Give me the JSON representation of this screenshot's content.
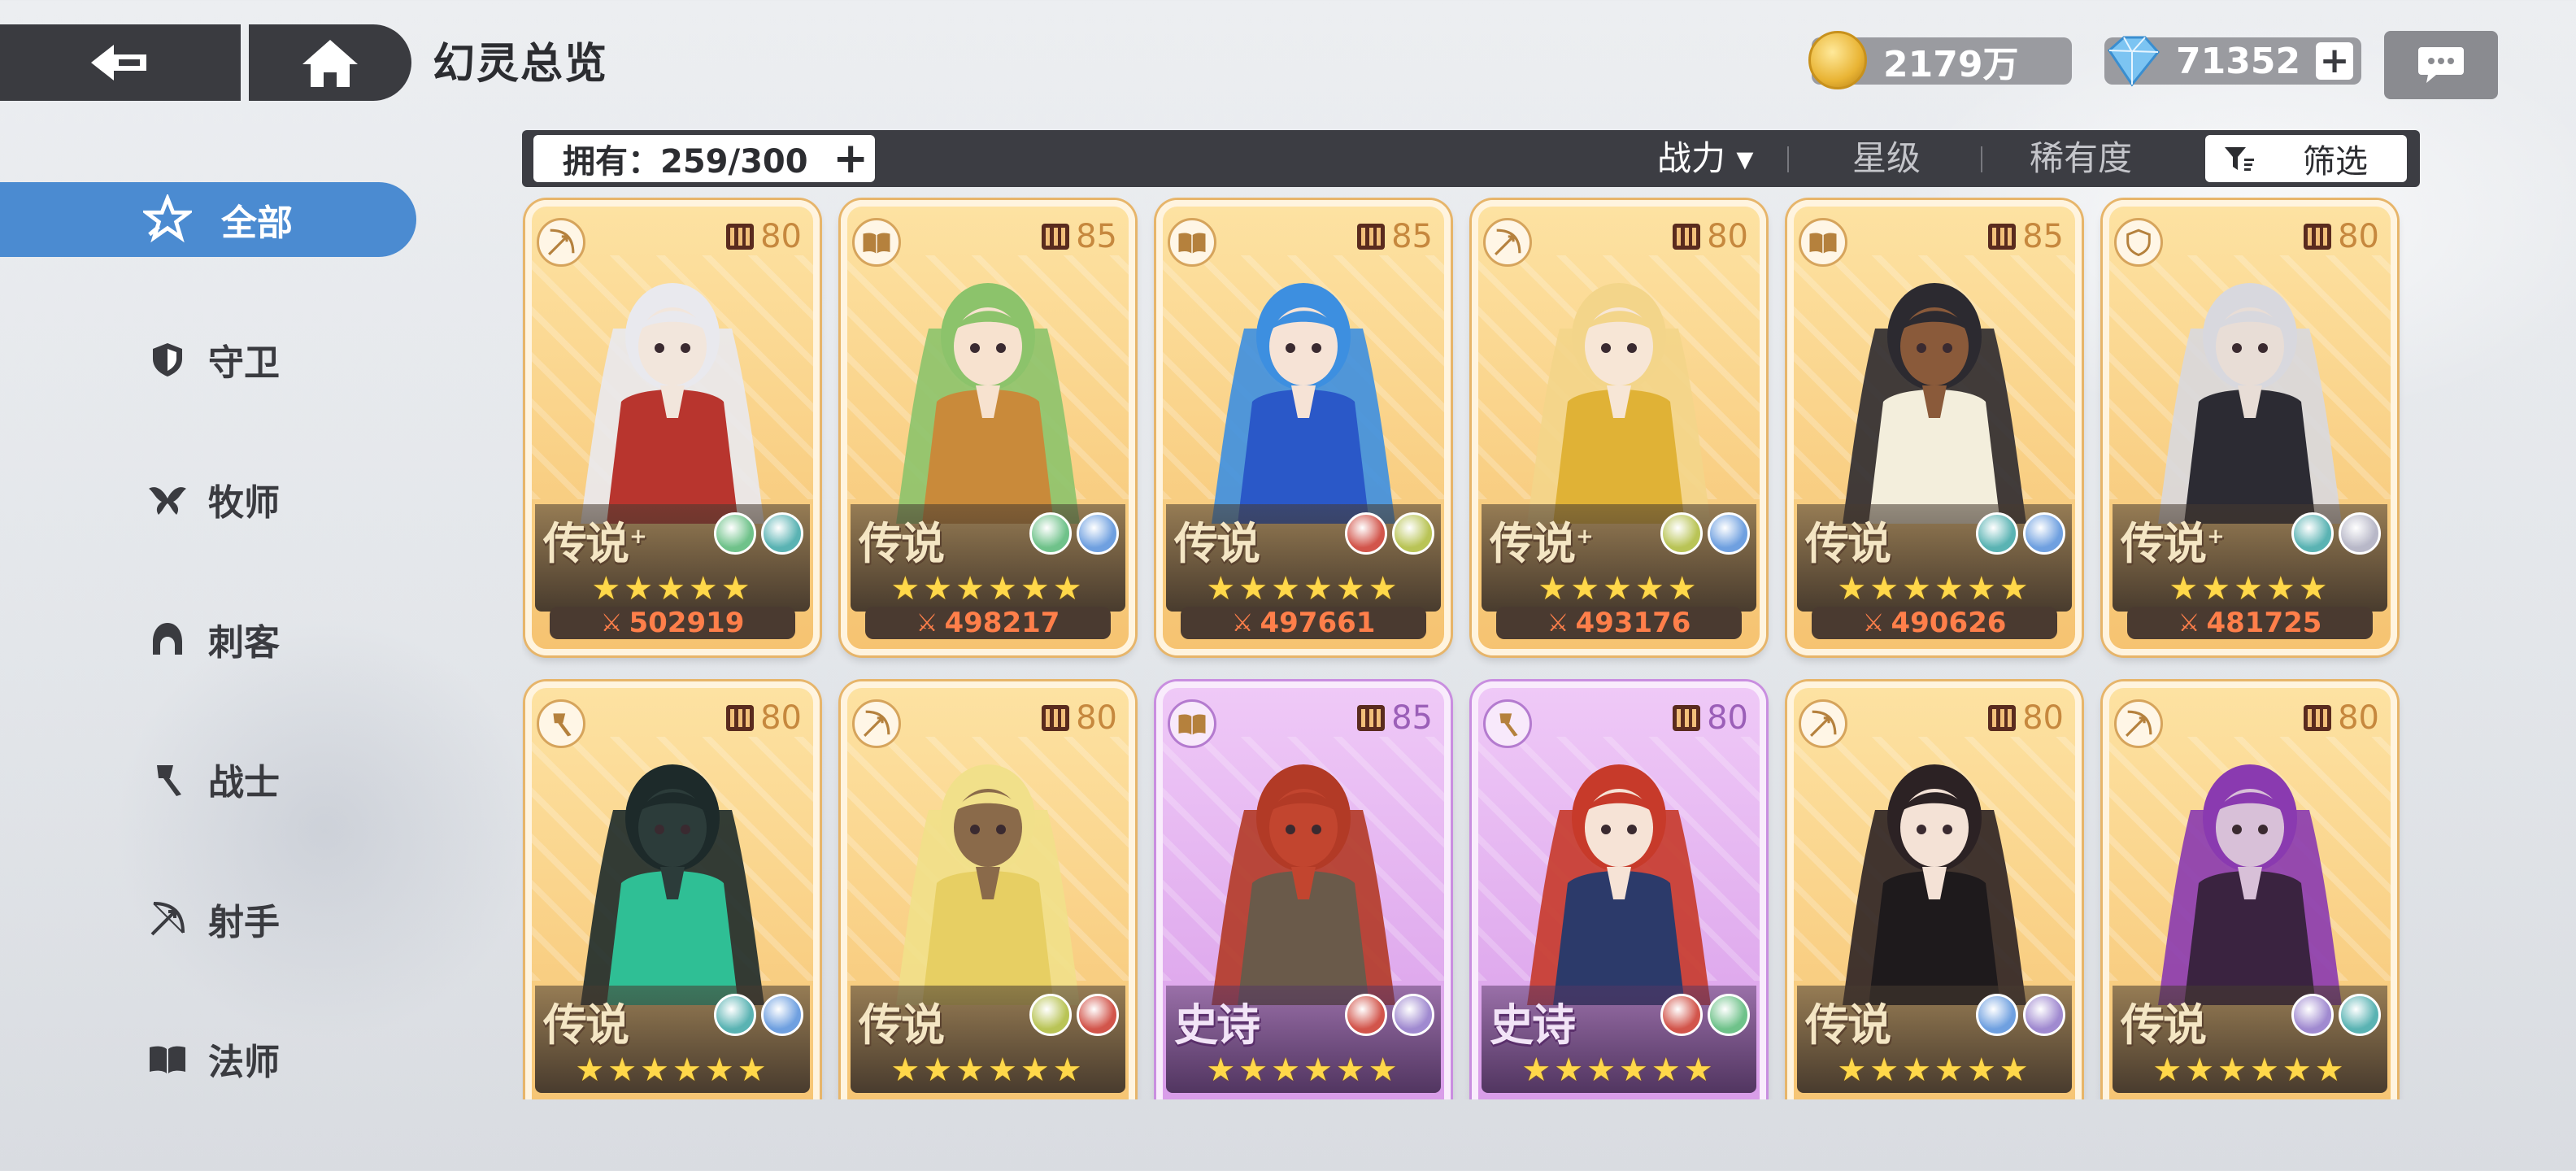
{
  "header": {
    "title": "幻灵总览",
    "gold": "2179万",
    "gems": "71352"
  },
  "filterbar": {
    "owned_label": "拥有：259/300",
    "sort_options": [
      {
        "label": "战力 ▾",
        "active": true
      },
      {
        "label": "星级",
        "active": false
      },
      {
        "label": "稀有度",
        "active": false
      }
    ],
    "filter_label": "筛选"
  },
  "sidebar": {
    "items": [
      {
        "label": "全部",
        "icon": "all-star-icon",
        "active": true
      },
      {
        "label": "守卫",
        "icon": "shield-icon"
      },
      {
        "label": "牧师",
        "icon": "wings-icon"
      },
      {
        "label": "刺客",
        "icon": "hood-icon"
      },
      {
        "label": "战士",
        "icon": "axe-icon"
      },
      {
        "label": "射手",
        "icon": "bow-icon"
      },
      {
        "label": "法师",
        "icon": "book-icon"
      }
    ]
  },
  "cards": [
    {
      "rarity": "传说",
      "rarity_plus": true,
      "level": "80",
      "class_icon": "bow-icon",
      "power": "502919",
      "stars": 5,
      "elements": [
        "#6fc28a",
        "#5ab3b3"
      ],
      "skin": "#f2e6dc",
      "hair": "#e9e9ee",
      "outfit": "#b8352e"
    },
    {
      "rarity": "传说",
      "rarity_plus": false,
      "level": "85",
      "class_icon": "book-icon",
      "power": "498217",
      "stars": 6,
      "elements": [
        "#6fc28a",
        "#6fa0e0"
      ],
      "skin": "#f7e2cf",
      "hair": "#8cc36b",
      "outfit": "#c98a3a"
    },
    {
      "rarity": "传说",
      "rarity_plus": false,
      "level": "85",
      "class_icon": "book-icon",
      "power": "497661",
      "stars": 6,
      "elements": [
        "#d2554b",
        "#b9c456"
      ],
      "skin": "#f6e3d6",
      "hair": "#3d8fe0",
      "outfit": "#2a58c8"
    },
    {
      "rarity": "传说",
      "rarity_plus": true,
      "level": "80",
      "class_icon": "bow-icon",
      "power": "493176",
      "stars": 5,
      "elements": [
        "#b9c456",
        "#6fa0e0"
      ],
      "skin": "#f7e6d6",
      "hair": "#f3d58a",
      "outfit": "#e0b236"
    },
    {
      "rarity": "传说",
      "rarity_plus": false,
      "level": "85",
      "class_icon": "book-icon",
      "power": "490626",
      "stars": 6,
      "elements": [
        "#5ab3b3",
        "#6fa0e0"
      ],
      "skin": "#8a5a3a",
      "hair": "#2c2a30",
      "outfit": "#f3eedc"
    },
    {
      "rarity": "传说",
      "rarity_plus": true,
      "level": "80",
      "class_icon": "shield-icon",
      "power": "481725",
      "stars": 5,
      "elements": [
        "#5ab3b3",
        "#b8b8c8"
      ],
      "skin": "#e8ddd6",
      "hair": "#d8d8de",
      "outfit": "#2c2b33"
    },
    {
      "rarity": "传说",
      "rarity_plus": false,
      "level": "80",
      "class_icon": "axe-icon",
      "power": "",
      "stars": 6,
      "elements": [
        "#5ab3b3",
        "#6fa0e0"
      ],
      "skin": "#2c3c3a",
      "hair": "#1d2a2a",
      "outfit": "#2fbf95"
    },
    {
      "rarity": "传说",
      "rarity_plus": false,
      "level": "80",
      "class_icon": "bow-icon",
      "power": "",
      "stars": 6,
      "elements": [
        "#b9c456",
        "#d2554b"
      ],
      "skin": "#8a6a4a",
      "hair": "#f1e08a",
      "outfit": "#e7cf63"
    },
    {
      "rarity": "史诗",
      "rarity_plus": false,
      "level": "85",
      "class_icon": "book-icon",
      "power": "",
      "stars": 6,
      "epic": true,
      "elements": [
        "#d2554b",
        "#a08ad0"
      ],
      "skin": "#c2452f",
      "hair": "#b23a26",
      "outfit": "#6a5a4a"
    },
    {
      "rarity": "史诗",
      "rarity_plus": false,
      "level": "80",
      "class_icon": "axe-icon",
      "power": "",
      "stars": 6,
      "epic": true,
      "elements": [
        "#d2554b",
        "#6fc28a"
      ],
      "skin": "#f6e3d6",
      "hair": "#c73a2a",
      "outfit": "#2c3a6a"
    },
    {
      "rarity": "传说",
      "rarity_plus": false,
      "level": "80",
      "class_icon": "bow-icon",
      "power": "",
      "stars": 6,
      "elements": [
        "#6fa0e0",
        "#a08ad0"
      ],
      "skin": "#f4e2d6",
      "hair": "#2c2224",
      "outfit": "#1e1a1c"
    },
    {
      "rarity": "传说",
      "rarity_plus": false,
      "level": "80",
      "class_icon": "bow-icon",
      "power": "",
      "stars": 6,
      "elements": [
        "#a08ad0",
        "#5ab3b3"
      ],
      "skin": "#d8c0d8",
      "hair": "#8a3ab0",
      "outfit": "#3a2340"
    }
  ]
}
